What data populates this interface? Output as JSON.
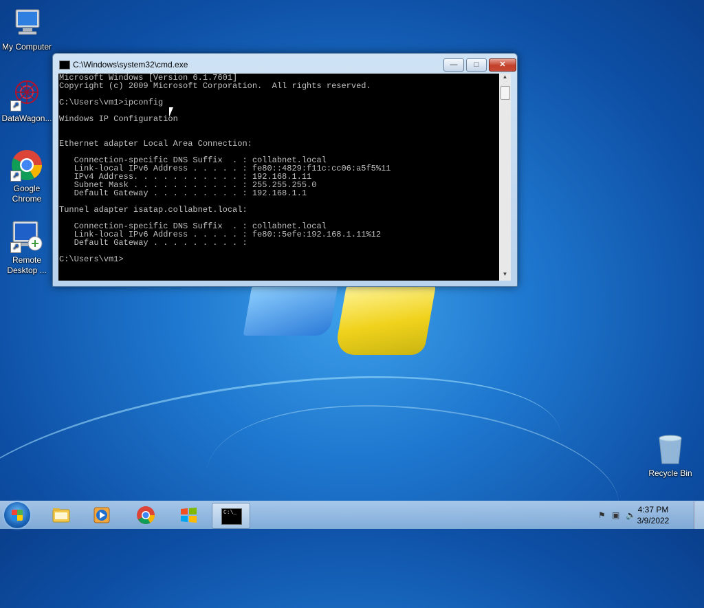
{
  "desktop": {
    "icons": [
      {
        "label": "My Computer"
      },
      {
        "label": "DataWagon..."
      },
      {
        "label": "Google Chrome"
      },
      {
        "label": "Remote Desktop ..."
      },
      {
        "label": "Recycle Bin"
      }
    ]
  },
  "window": {
    "title": "C:\\Windows\\system32\\cmd.exe",
    "min_label": "—",
    "max_label": "□",
    "close_label": "✕",
    "console_text": "Microsoft Windows [Version 6.1.7601]\nCopyright (c) 2009 Microsoft Corporation.  All rights reserved.\n\nC:\\Users\\vm1>ipconfig\n\nWindows IP Configuration\n\n\nEthernet adapter Local Area Connection:\n\n   Connection-specific DNS Suffix  . : collabnet.local\n   Link-local IPv6 Address . . . . . : fe80::4829:f11c:cc06:a5f5%11\n   IPv4 Address. . . . . . . . . . . : 192.168.1.11\n   Subnet Mask . . . . . . . . . . . : 255.255.255.0\n   Default Gateway . . . . . . . . . : 192.168.1.1\n\nTunnel adapter isatap.collabnet.local:\n\n   Connection-specific DNS Suffix  . : collabnet.local\n   Link-local IPv6 Address . . . . . : fe80::5efe:192.168.1.11%12\n   Default Gateway . . . . . . . . . :\n\nC:\\Users\\vm1>"
  },
  "taskbar": {
    "items": [
      {
        "icon": "file-explorer-icon"
      },
      {
        "icon": "media-player-icon"
      },
      {
        "icon": "chrome-icon"
      },
      {
        "icon": "windows-logo-icon"
      },
      {
        "icon": "cmd-icon",
        "label": "C:\\_"
      }
    ],
    "clock": {
      "time": "4:37 PM",
      "date": "3/9/2022"
    }
  }
}
